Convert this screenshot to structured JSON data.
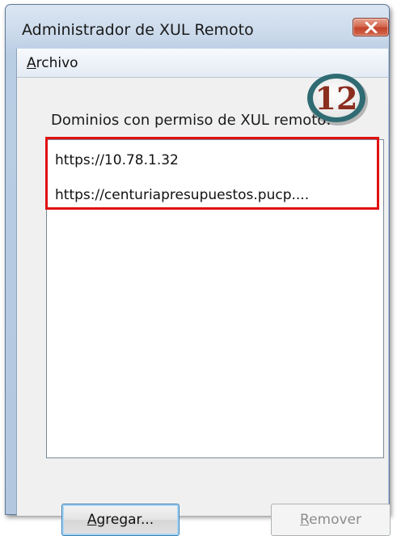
{
  "window": {
    "title": "Administrador de XUL Remoto"
  },
  "menu": {
    "archivo_first": "A",
    "archivo_rest": "rchivo"
  },
  "badge": {
    "number": "12",
    "ring_color": "#2f6b72",
    "number_color": "#8b2e1e"
  },
  "main": {
    "domains_label": "Dominios con permiso de XUL remoto:",
    "domains": [
      "https://10.78.1.32",
      "https://centuriapresupuestos.pucp...."
    ]
  },
  "buttons": {
    "add_first": "A",
    "add_rest": "gregar...",
    "remove_first": "R",
    "remove_rest": "emover"
  },
  "colors": {
    "highlight": "#e01010",
    "close_button": "#c4422a"
  }
}
